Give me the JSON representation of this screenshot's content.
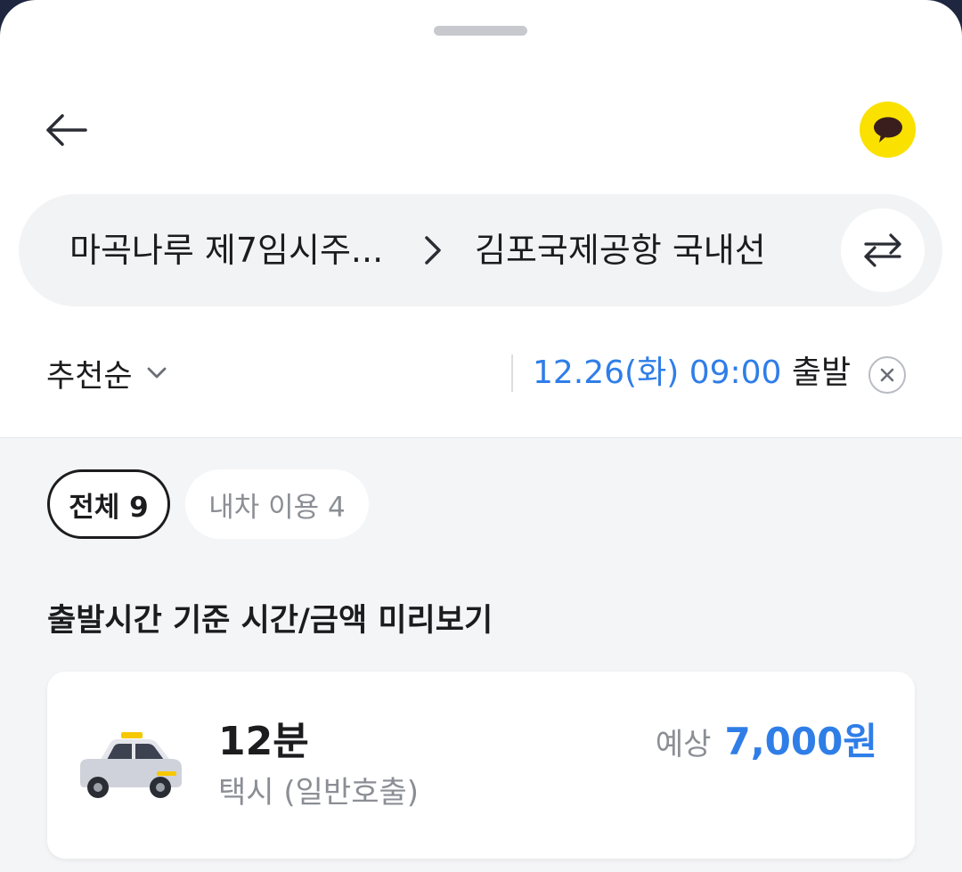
{
  "header": {
    "back_icon": "arrow-left-icon",
    "kakao_icon": "kakaotalk-chat-icon",
    "kakao_color": "#fae100"
  },
  "route": {
    "origin": "마곡나루 제7임시주...",
    "destination": "김포국제공항 국내선",
    "swap_icon": "swap-arrows-icon"
  },
  "filter": {
    "sort_label": "추천순",
    "departure_time": "12.26(화) 09:00",
    "departure_suffix": "출발",
    "accent_color": "#2f7ee8"
  },
  "chips": [
    {
      "label": "전체 9",
      "selected": true
    },
    {
      "label": "내차 이용 4",
      "selected": false
    }
  ],
  "section_title": "출발시간 기준 시간/금액 미리보기",
  "results": [
    {
      "icon": "taxi-icon",
      "duration": "12분",
      "type": "택시 (일반호출)",
      "price_label": "예상",
      "price": "7,000원"
    }
  ]
}
